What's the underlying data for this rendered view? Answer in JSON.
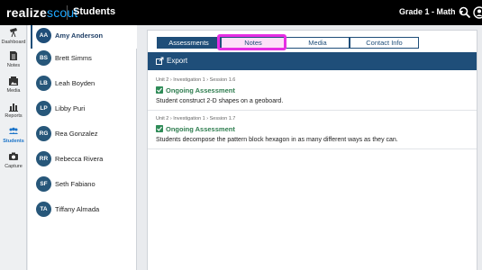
{
  "brand": {
    "part1": "realize",
    "part2": "scout"
  },
  "app_title": "Students",
  "grade_selector": "Grade 1 - Math",
  "nav": [
    {
      "label": "Dashboard",
      "icon": "telescope-icon"
    },
    {
      "label": "Notes",
      "icon": "notes-icon"
    },
    {
      "label": "Media",
      "icon": "media-icon"
    },
    {
      "label": "Reports",
      "icon": "reports-icon"
    },
    {
      "label": "Students",
      "icon": "students-icon"
    },
    {
      "label": "Capture",
      "icon": "camera-icon"
    }
  ],
  "students": [
    {
      "initials": "AA",
      "name": "Amy Anderson"
    },
    {
      "initials": "BS",
      "name": "Brett Simms"
    },
    {
      "initials": "LB",
      "name": "Leah Boyden"
    },
    {
      "initials": "LP",
      "name": "Libby Puri"
    },
    {
      "initials": "RG",
      "name": "Rea Gonzalez"
    },
    {
      "initials": "RR",
      "name": "Rebecca Rivera"
    },
    {
      "initials": "SF",
      "name": "Seth Fabiano"
    },
    {
      "initials": "TA",
      "name": "Tiffany Almada"
    }
  ],
  "tabs": [
    "Assessments",
    "Notes",
    "Media",
    "Contact Info"
  ],
  "export_label": "Export",
  "entries": [
    {
      "crumb": "Unit 2 › Investigation 1 › Session 1.6",
      "type": "Ongoing Assessment",
      "desc": "Student construct 2-D shapes on a geoboard."
    },
    {
      "crumb": "Unit 2 › Investigation 1 › Session 1.7",
      "type": "Ongoing Assessment",
      "desc": "Students decompose the pattern block hexagon in as many different ways as they can."
    }
  ]
}
